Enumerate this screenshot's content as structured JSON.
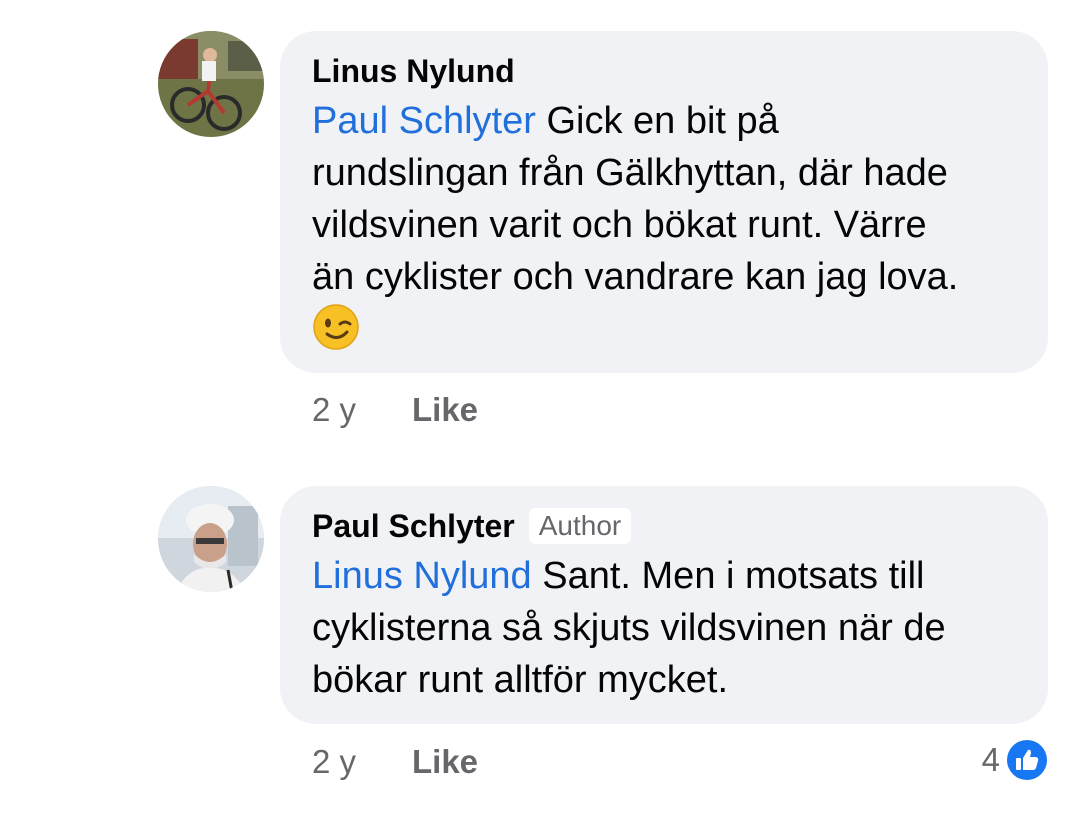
{
  "comments": [
    {
      "author": "Linus Nylund",
      "badge": "",
      "mention": "Paul Schlyter",
      "text_lines": [
        " Gick en bit på",
        "rundslingan från Gälkhyttan, där hade",
        "vildsvinen varit och bökat runt. Värre",
        "än cyklister och vandrare kan jag lova."
      ],
      "emoji": "winking-face",
      "time": "2 y",
      "like_label": "Like"
    },
    {
      "author": "Paul Schlyter",
      "badge": "Author",
      "mention": "Linus Nylund",
      "text_lines": [
        " Sant. Men i motsats till",
        "cyklisterna så skjuts vildsvinen när de",
        "bökar runt alltför mycket."
      ],
      "time": "2 y",
      "like_label": "Like",
      "reaction_count": "4",
      "reaction_icon": "thumbs-up-icon"
    }
  ],
  "colors": {
    "mention": "#216fdb",
    "bubble": "#f0f2f5",
    "secondary_text": "#65676b",
    "like_reaction": "#1877f2"
  }
}
